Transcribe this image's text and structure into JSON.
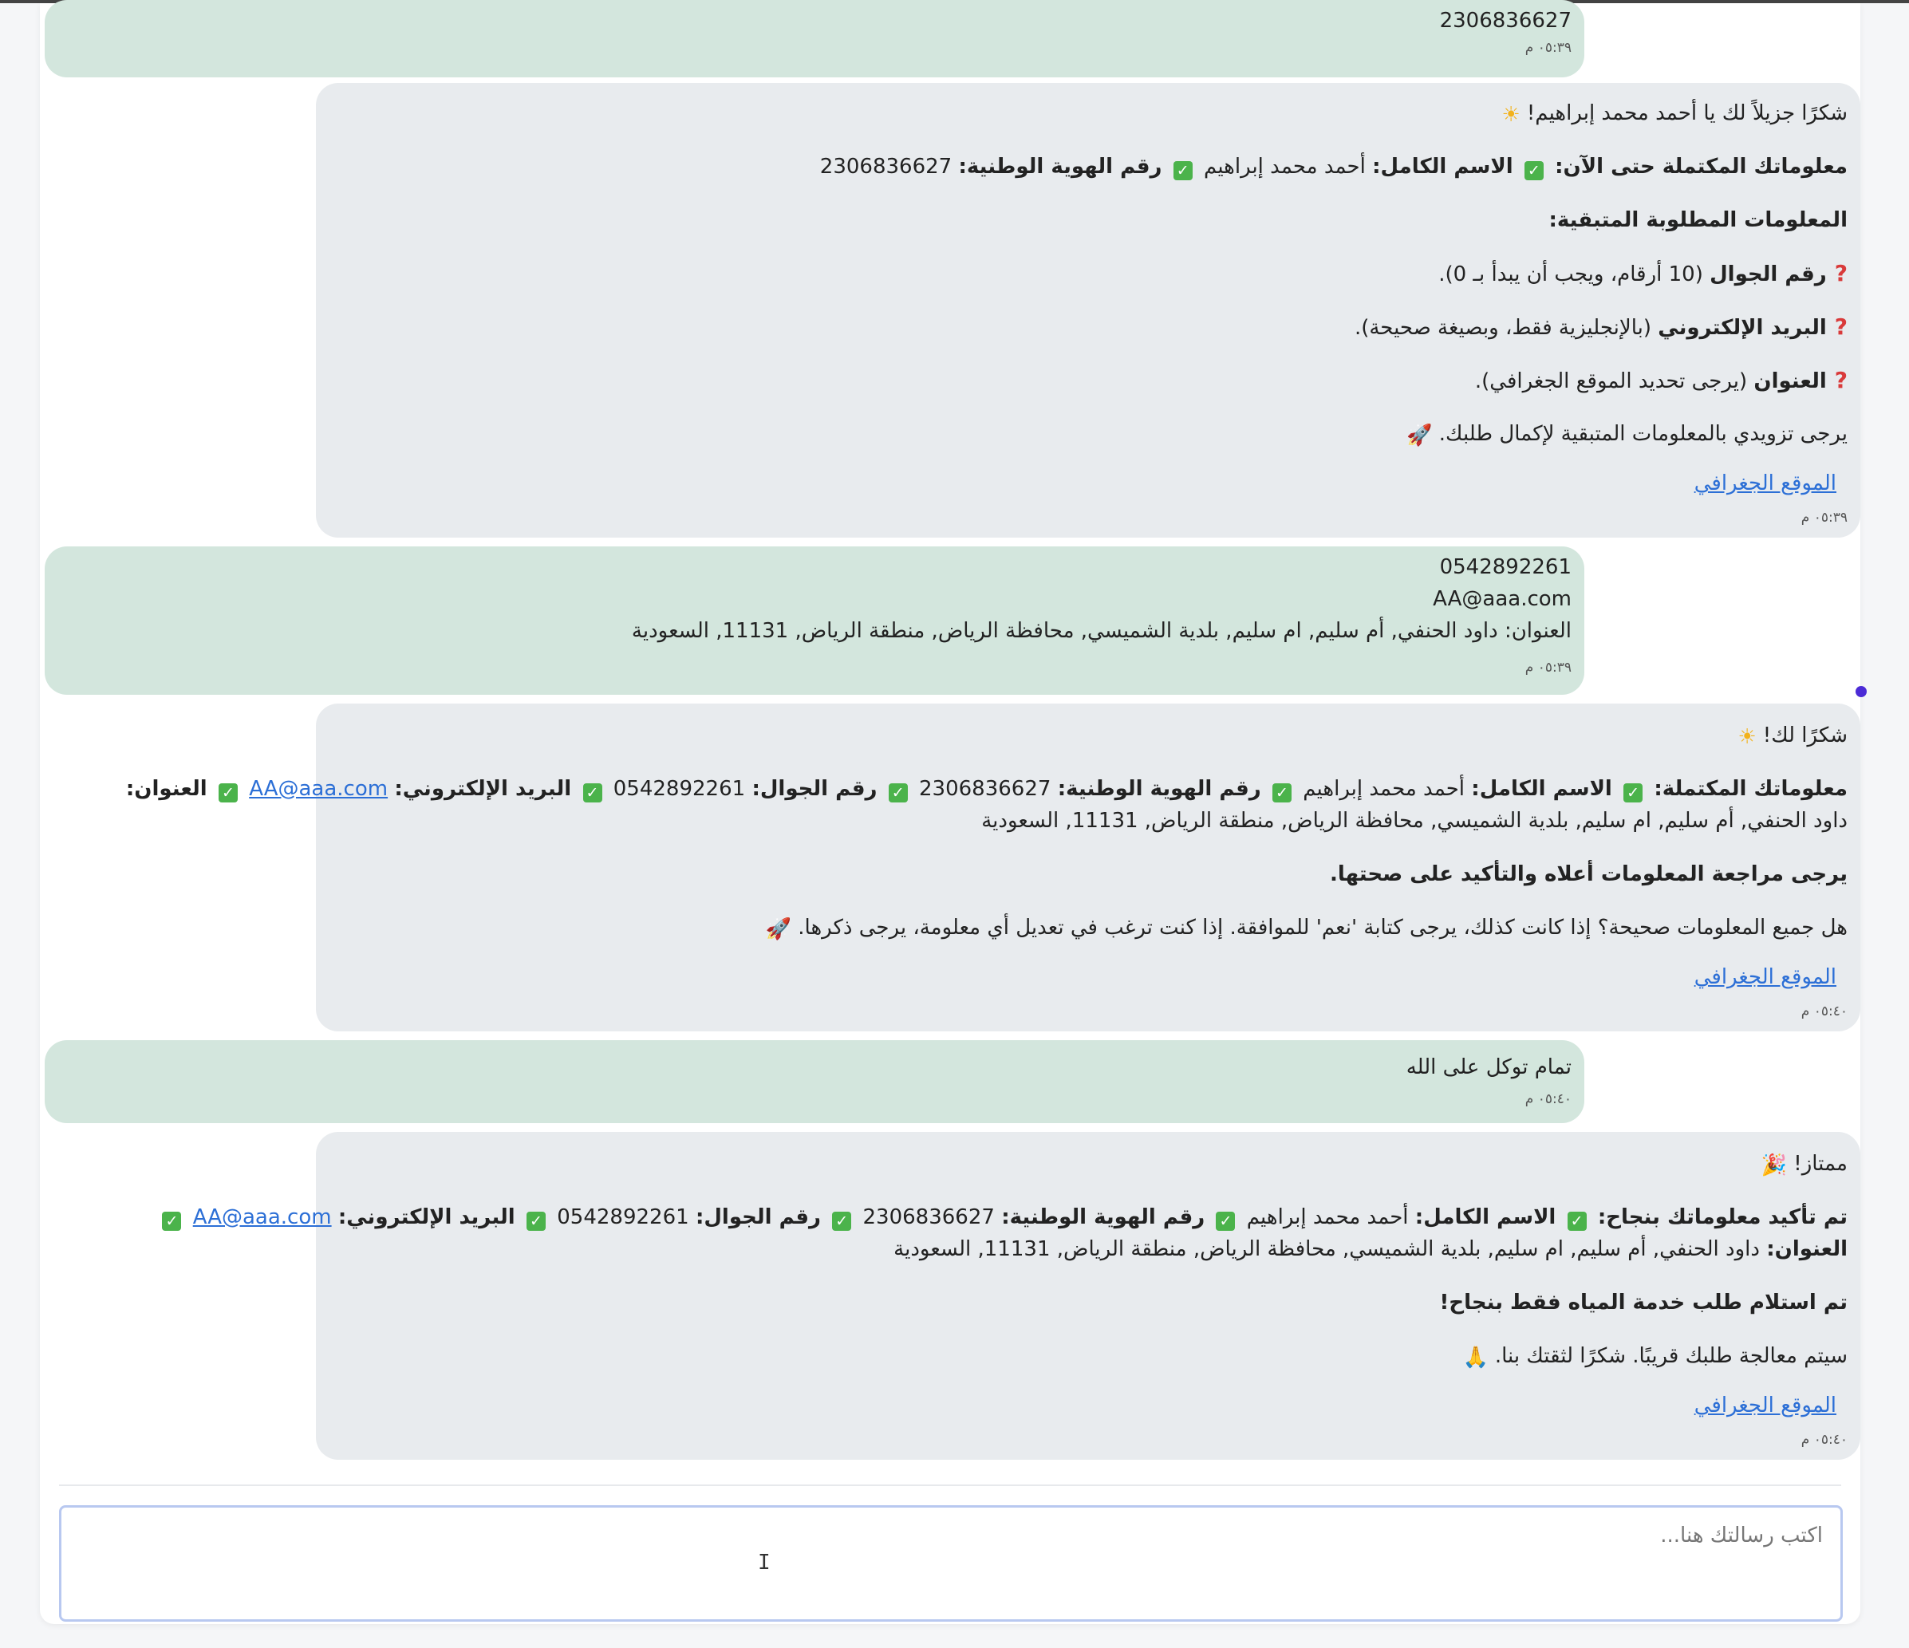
{
  "messages": [
    {
      "role": "user",
      "lines": [
        "2306836627"
      ],
      "time": "٠٥:٣٩ م"
    },
    {
      "role": "bot",
      "greeting": "شكرًا جزيلاً لك يا أحمد محمد إبراهيم!",
      "info_heading": "معلوماتك المكتملة حتى الآن:",
      "name_label": "الاسم الكامل:",
      "name_value": "أحمد محمد إبراهيم",
      "id_label": "رقم الهوية الوطنية:",
      "id_value": "2306836627",
      "remaining_heading": "المعلومات المطلوبة المتبقية:",
      "r1_label": "رقم الجوال",
      "r1_text": "(10 أرقام، ويجب أن يبدأ بـ 0).",
      "r2_label": "البريد الإلكتروني",
      "r2_text": "(بالإنجليزية فقط، وبصيغة صحيحة).",
      "r3_label": "العنوان",
      "r3_text": "(يرجى تحديد الموقع الجغرافي).",
      "closing": "يرجى تزويدي بالمعلومات المتبقية لإكمال طلبك.",
      "map_link": "الموقع الجغرافي",
      "time": "٠٥:٣٩ م"
    },
    {
      "role": "user",
      "lines": [
        "0542892261",
        "AA@aaa.com",
        "العنوان: داود الحنفي, أم سليم, ام سليم, بلدية الشميسي, محافظة الرياض, منطقة الرياض, 11131, السعودية"
      ],
      "time": "٠٥:٣٩ م"
    },
    {
      "role": "bot",
      "greeting": "شكرًا لك!",
      "info_heading": "معلوماتك المكتملة:",
      "name_label": "الاسم الكامل:",
      "name_value": "أحمد محمد إبراهيم",
      "id_label": "رقم الهوية الوطنية:",
      "id_value": "2306836627",
      "phone_label": "رقم الجوال:",
      "phone_value": "0542892261",
      "email_label": "البريد الإلكتروني:",
      "email_value": "AA@aaa.com",
      "address_label": "العنوان:",
      "address_value": "داود الحنفي, أم سليم, ام سليم, بلدية الشميسي, محافظة الرياض, منطقة الرياض, 11131, السعودية",
      "review": "يرجى مراجعة المعلومات أعلاه والتأكيد على صحتها.",
      "question": "هل جميع المعلومات صحيحة؟ إذا كانت كذلك، يرجى كتابة 'نعم' للموافقة. إذا كنت ترغب في تعديل أي معلومة، يرجى ذكرها.",
      "map_link": "الموقع الجغرافي",
      "time": "٠٥:٤٠ م"
    },
    {
      "role": "user",
      "lines": [
        "تمام توكل على الله"
      ],
      "time": "٠٥:٤٠ م"
    },
    {
      "role": "bot",
      "greeting": "ممتاز!",
      "info_heading": "تم تأكيد معلوماتك بنجاح:",
      "name_label": "الاسم الكامل:",
      "name_value": "أحمد محمد إبراهيم",
      "id_label": "رقم الهوية الوطنية:",
      "id_value": "2306836627",
      "phone_label": "رقم الجوال:",
      "phone_value": "0542892261",
      "email_label": "البريد الإلكتروني:",
      "email_value": "AA@aaa.com",
      "address_label": "العنوان:",
      "address_value": "داود الحنفي, أم سليم, ام سليم, بلدية الشميسي, محافظة الرياض, منطقة الرياض, 11131, السعودية",
      "received": "تم استلام طلب خدمة المياه فقط بنجاح!",
      "closing": "سيتم معالجة طلبك قريبًا. شكرًا لثقتك بنا.",
      "map_link": "الموقع الجغرافي",
      "time": "٠٥:٤٠ م"
    }
  ],
  "composer": {
    "placeholder": "اكتب رسالتك هنا..."
  }
}
